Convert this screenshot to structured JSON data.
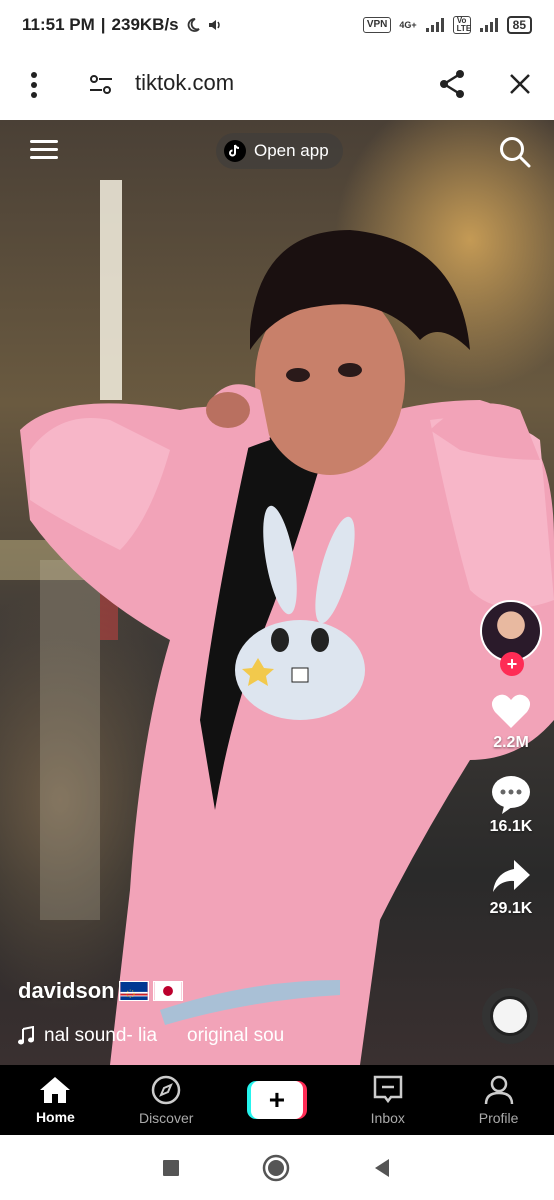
{
  "status_bar": {
    "time": "11:51 PM",
    "speed": "239KB/s",
    "vpn": "VPN",
    "network": "4G+",
    "volte": "Vo LTE",
    "battery": "85"
  },
  "browser": {
    "url": "tiktok.com",
    "menu_icon": "more-vertical-icon",
    "site_settings_icon": "tune-icon",
    "share_icon": "share-icon",
    "close_icon": "close-icon"
  },
  "video": {
    "open_app_label": "Open app",
    "username": "davidson",
    "sound_text_1": "nal sound- lia",
    "sound_text_2": "original sou",
    "likes": "2.2M",
    "comments": "16.1K",
    "shares": "29.1K"
  },
  "tabs": [
    {
      "label": "Home",
      "icon": "home-icon"
    },
    {
      "label": "Discover",
      "icon": "compass-icon"
    },
    {
      "label": "",
      "icon": "plus-icon"
    },
    {
      "label": "Inbox",
      "icon": "inbox-icon"
    },
    {
      "label": "Profile",
      "icon": "person-icon"
    }
  ],
  "colors": {
    "accent_red": "#fe2c55",
    "accent_cyan": "#25f4ee"
  }
}
